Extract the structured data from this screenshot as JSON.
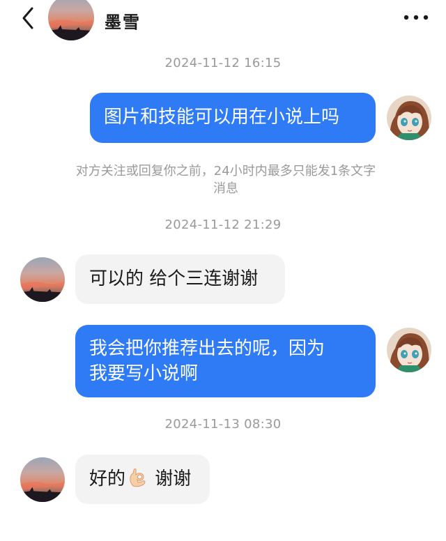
{
  "header": {
    "back_icon": "chevron-left-icon",
    "contact_name": "墨雪",
    "more_icon": "more-horizontal-icon"
  },
  "messages": [
    {
      "type": "timestamp",
      "text": "2024-11-12 16:15"
    },
    {
      "type": "outgoing",
      "text": "图片和技能可以用在小说上吗"
    },
    {
      "type": "notice",
      "line1": "对方关注或回复你之前，24小时内最多只能发1条文字",
      "line2": "消息"
    },
    {
      "type": "timestamp",
      "text": "2024-11-12 21:29"
    },
    {
      "type": "incoming",
      "text": "可以的 给个三连谢谢"
    },
    {
      "type": "outgoing",
      "line1": "我会把你推荐出去的呢，因为",
      "line2": "我要写小说啊"
    },
    {
      "type": "timestamp",
      "text": "2024-11-13 08:30"
    },
    {
      "type": "incoming",
      "before_emoji": "好的",
      "emoji": "ok-hand-icon",
      "after_emoji": " 谢谢"
    }
  ],
  "colors": {
    "outgoing_bubble": "#2f7bf5",
    "incoming_bubble": "#f3f3f3",
    "timestamp_text": "#9a9a9a"
  }
}
